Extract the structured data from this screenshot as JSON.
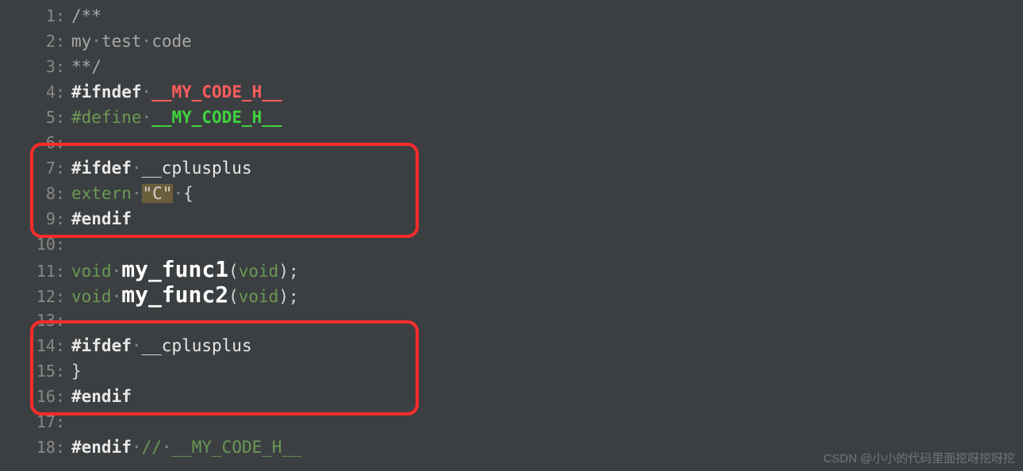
{
  "lines": {
    "l1": {
      "num": "1:",
      "comment": "/**"
    },
    "l2": {
      "num": "2:",
      "p1": "my",
      "p2": "test",
      "p3": "code"
    },
    "l3": {
      "num": "3:",
      "comment": "**/"
    },
    "l4": {
      "num": "4:",
      "kw": "#ifndef",
      "macro": "__MY_CODE_H__"
    },
    "l5": {
      "num": "5:",
      "kw": "#define",
      "macro": "__MY_CODE_H__"
    },
    "l6": {
      "num": "6:"
    },
    "l7": {
      "num": "7:",
      "kw": "#ifdef",
      "sym": "__cplusplus"
    },
    "l8": {
      "num": "8:",
      "kw": "extern",
      "str": "\"C\"",
      "brace": "{"
    },
    "l9": {
      "num": "9:",
      "kw": "#endif"
    },
    "l10": {
      "num": "10:"
    },
    "l11": {
      "num": "11:",
      "type": "void",
      "name": "my_func1",
      "arg": "void"
    },
    "l12": {
      "num": "12:",
      "type": "void",
      "name": "my_func2",
      "arg": "void"
    },
    "l13": {
      "num": "13:"
    },
    "l14": {
      "num": "14:",
      "kw": "#ifdef",
      "sym": "__cplusplus"
    },
    "l15": {
      "num": "15:",
      "brace": "}"
    },
    "l16": {
      "num": "16:",
      "kw": "#endif"
    },
    "l17": {
      "num": "17:"
    },
    "l18": {
      "num": "18:",
      "kw": "#endif",
      "comment": "//",
      "macro": "__MY_CODE_H__"
    }
  },
  "dots": {
    "mid": "·"
  },
  "punct": {
    "open": "(",
    "close": ")",
    "semi": ";"
  },
  "watermark": "CSDN @小小的代码里面挖呀挖呀挖"
}
